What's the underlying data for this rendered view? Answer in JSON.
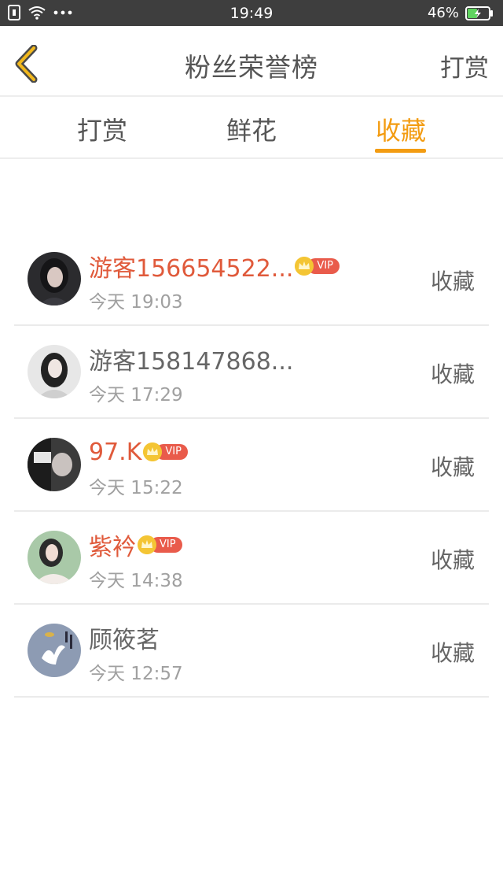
{
  "status_bar": {
    "time": "19:49",
    "battery_percent": "46%",
    "battery_level": 0.46,
    "icons": [
      "sim-icon",
      "wifi-icon",
      "more-dots-icon",
      "battery-charging-icon"
    ]
  },
  "header": {
    "title": "粉丝荣誉榜",
    "action_label": "打赏",
    "back_icon": "chevron-left-icon"
  },
  "tabs": [
    {
      "label": "打赏",
      "active": false
    },
    {
      "label": "鲜花",
      "active": false
    },
    {
      "label": "收藏",
      "active": true
    }
  ],
  "accent_color": "#f39c12",
  "vip_name_color": "#e05a3b",
  "entries": [
    {
      "name": "游客156654522...",
      "vip": true,
      "vip_label": "VIP",
      "time": "今天 19:03",
      "action": "收藏"
    },
    {
      "name": "游客158147868...",
      "vip": false,
      "time": "今天 17:29",
      "action": "收藏"
    },
    {
      "name": "97.K",
      "vip": true,
      "vip_label": "VIP",
      "time": "今天 15:22",
      "action": "收藏"
    },
    {
      "name": "紫衿",
      "vip": true,
      "vip_label": "VIP",
      "time": "今天 14:38",
      "action": "收藏"
    },
    {
      "name": "顾筱茗",
      "vip": false,
      "time": "今天 12:57",
      "action": "收藏"
    }
  ]
}
